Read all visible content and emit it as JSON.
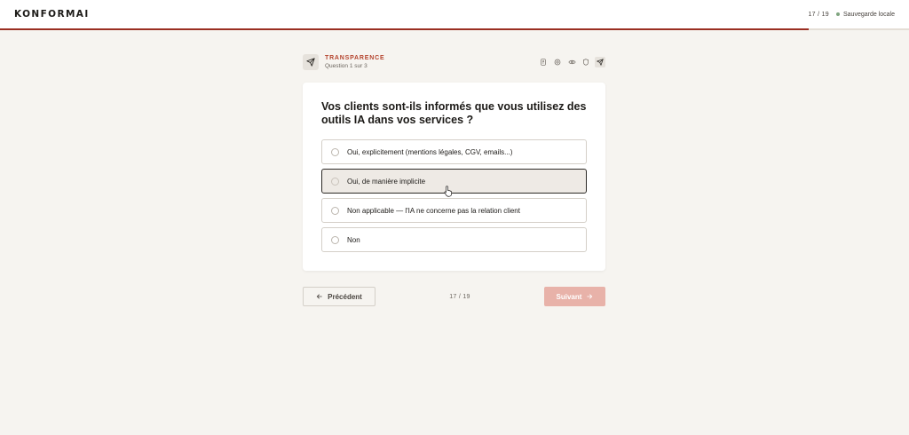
{
  "header": {
    "logo": "KONFORMAI",
    "counter": "17 / 19",
    "save_status": "Sauvegarde locale"
  },
  "progress": {
    "fraction": 0.89,
    "color": "#9a2e22"
  },
  "section": {
    "icon": "send-icon",
    "title": "TRANSPARENCE",
    "subtitle": "Question 1 sur 3",
    "category_icons": [
      "document-icon",
      "settings-icon",
      "eye-icon",
      "shield-icon",
      "send-icon"
    ],
    "active_category": "send-icon"
  },
  "question": {
    "text": "Vos clients sont-ils informés que vous utilisez des outils IA dans vos services ?",
    "options": [
      {
        "label": "Oui, explicitement (mentions légales, CGV, emails...)"
      },
      {
        "label": "Oui, de manière implicite",
        "hovered": true
      },
      {
        "label": "Non applicable — l'IA ne concerne pas la relation client"
      },
      {
        "label": "Non"
      }
    ]
  },
  "nav": {
    "prev_label": "Précédent",
    "page_indicator": "17 / 19",
    "next_label": "Suivant",
    "next_enabled": false
  },
  "colors": {
    "accent": "#b5452f",
    "background": "#f6f4f0",
    "next_disabled": "#e8b2a9",
    "save_dot": "#7fa57f"
  }
}
